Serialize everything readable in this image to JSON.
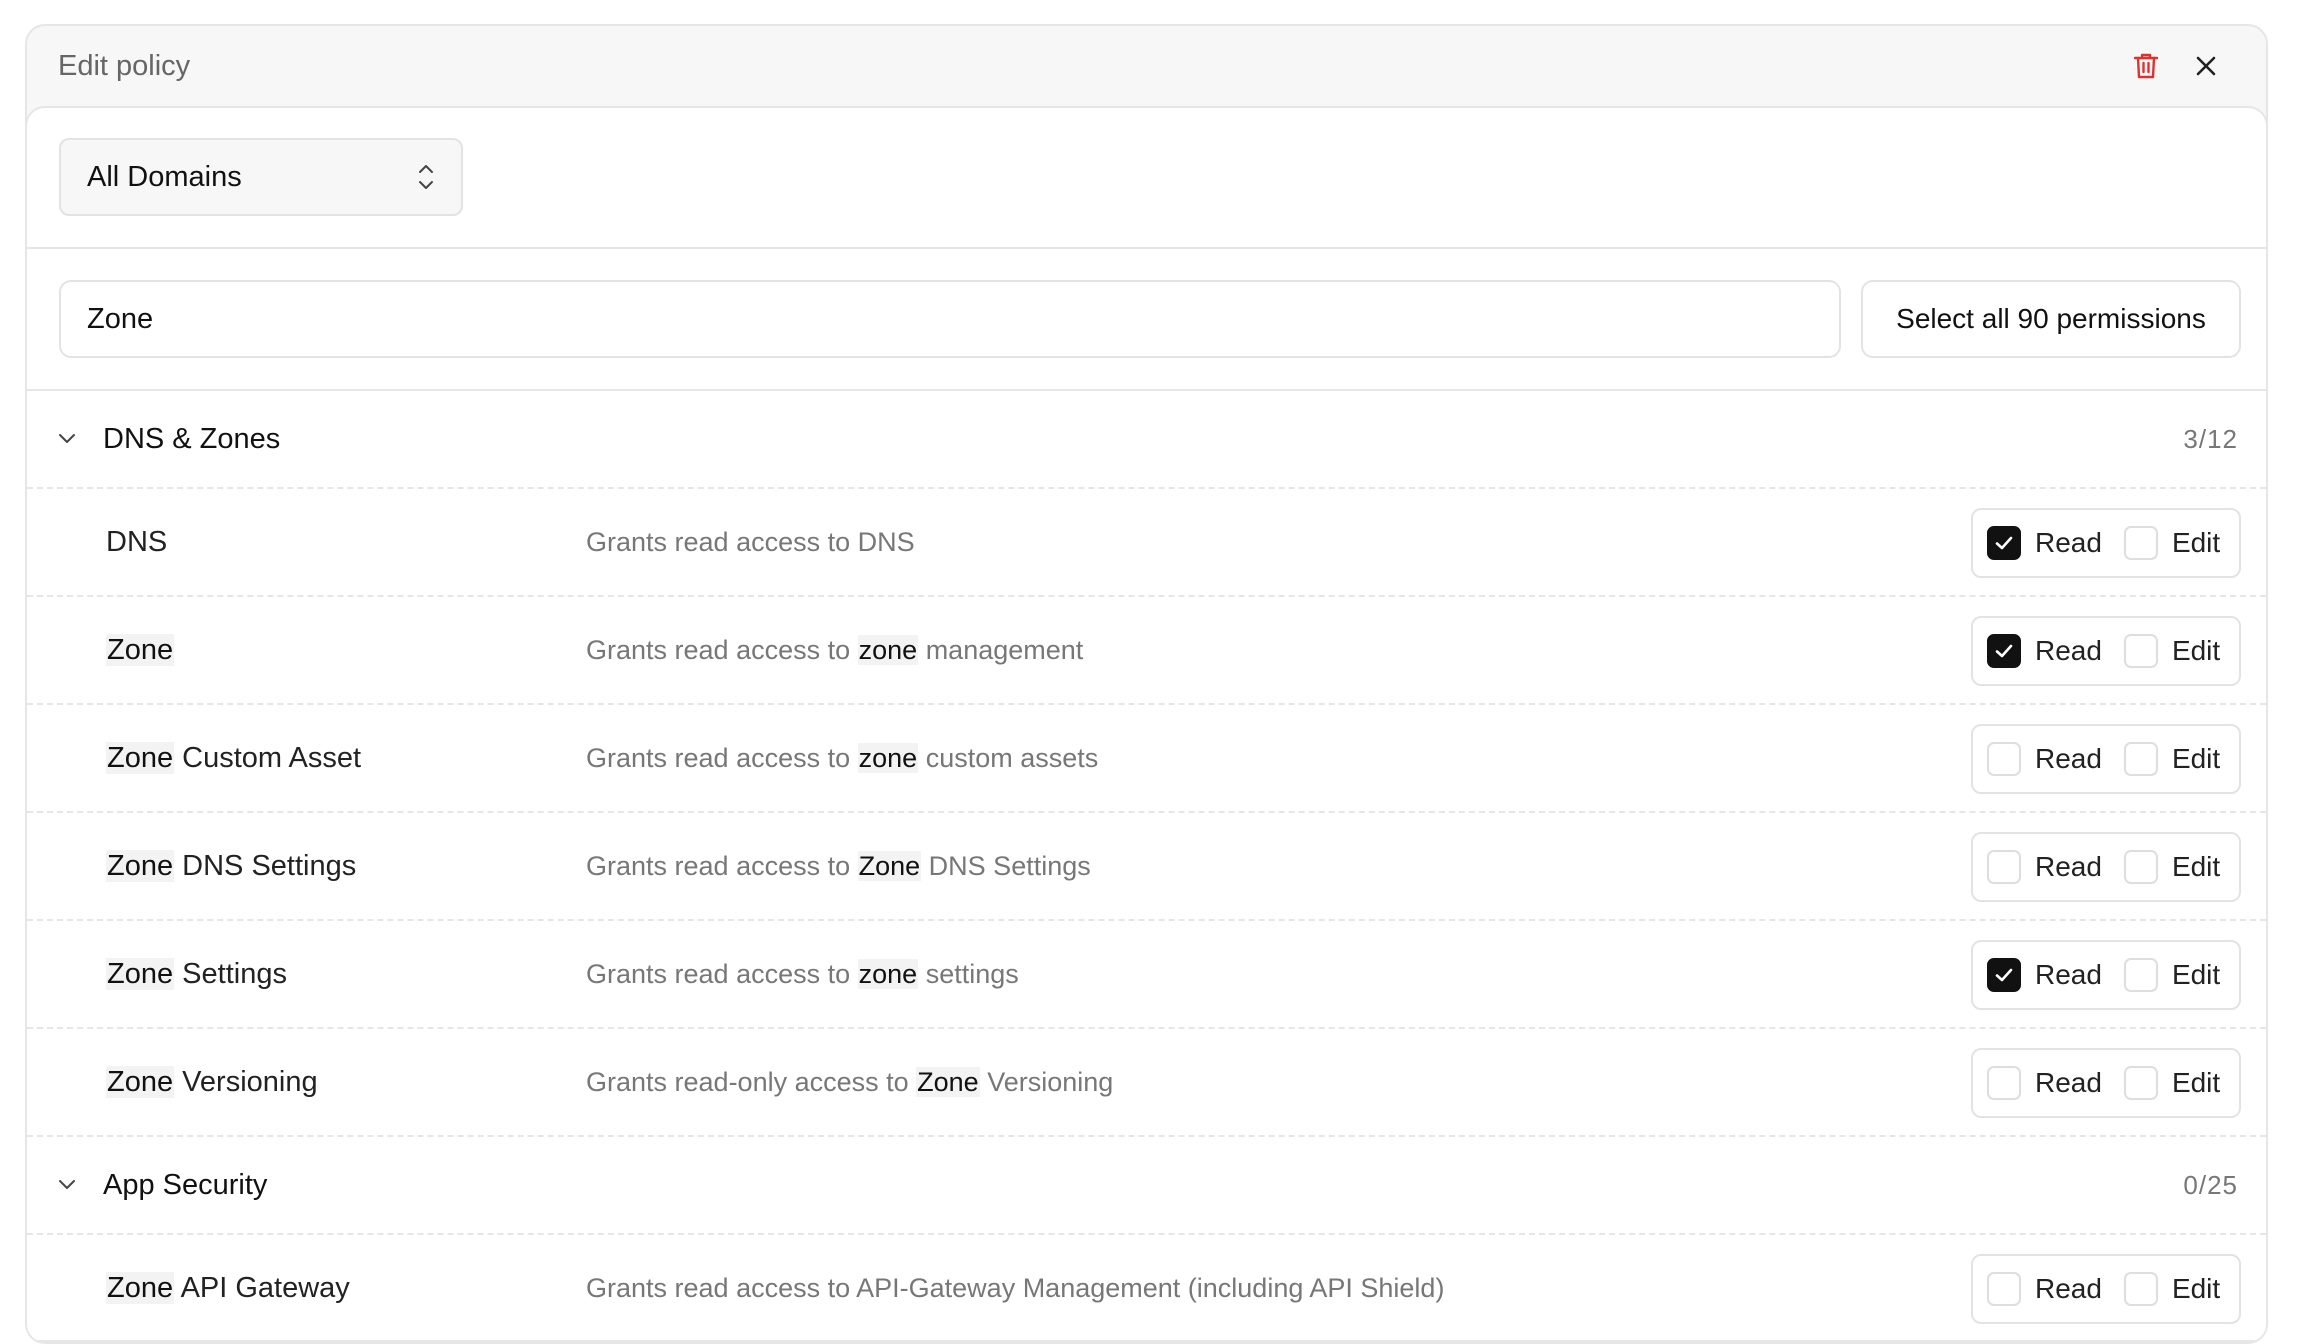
{
  "header": {
    "title": "Edit policy"
  },
  "domain_select": {
    "value": "All Domains"
  },
  "search": {
    "value": "Zone",
    "select_all_label": "Select all 90 permissions"
  },
  "colors": {
    "accent_delete": "#e03131",
    "checked_fill": "#111111"
  },
  "groups": [
    {
      "title": "DNS & Zones",
      "count": "3/12",
      "rows": [
        {
          "name_hl": "",
          "name_rest": "DNS",
          "desc_pre": "Grants read access to DNS",
          "desc_hl": "",
          "desc_post": "",
          "read_label": "Read",
          "edit_label": "Edit",
          "read_checked": true,
          "edit_checked": false
        },
        {
          "name_hl": "Zone",
          "name_rest": "",
          "desc_pre": "Grants read access to ",
          "desc_hl": "zone",
          "desc_post": " management",
          "read_label": "Read",
          "edit_label": "Edit",
          "read_checked": true,
          "edit_checked": false
        },
        {
          "name_hl": "Zone",
          "name_rest": " Custom Asset",
          "desc_pre": "Grants read access to ",
          "desc_hl": "zone",
          "desc_post": " custom assets",
          "read_label": "Read",
          "edit_label": "Edit",
          "read_checked": false,
          "edit_checked": false
        },
        {
          "name_hl": "Zone",
          "name_rest": " DNS Settings",
          "desc_pre": "Grants read access to ",
          "desc_hl": "Zone",
          "desc_post": " DNS Settings",
          "read_label": "Read",
          "edit_label": "Edit",
          "read_checked": false,
          "edit_checked": false
        },
        {
          "name_hl": "Zone",
          "name_rest": " Settings",
          "desc_pre": "Grants read access to ",
          "desc_hl": "zone",
          "desc_post": " settings",
          "read_label": "Read",
          "edit_label": "Edit",
          "read_checked": true,
          "edit_checked": false
        },
        {
          "name_hl": "Zone",
          "name_rest": " Versioning",
          "desc_pre": "Grants read-only access to ",
          "desc_hl": "Zone",
          "desc_post": " Versioning",
          "read_label": "Read",
          "edit_label": "Edit",
          "read_checked": false,
          "edit_checked": false
        }
      ]
    },
    {
      "title": "App Security",
      "count": "0/25",
      "rows": [
        {
          "name_hl": "Zone",
          "name_rest": " API Gateway",
          "desc_pre": "Grants read access to API-Gateway Management (including API Shield)",
          "desc_hl": "",
          "desc_post": "",
          "read_label": "Read",
          "edit_label": "Edit",
          "read_checked": false,
          "edit_checked": false
        }
      ]
    }
  ]
}
